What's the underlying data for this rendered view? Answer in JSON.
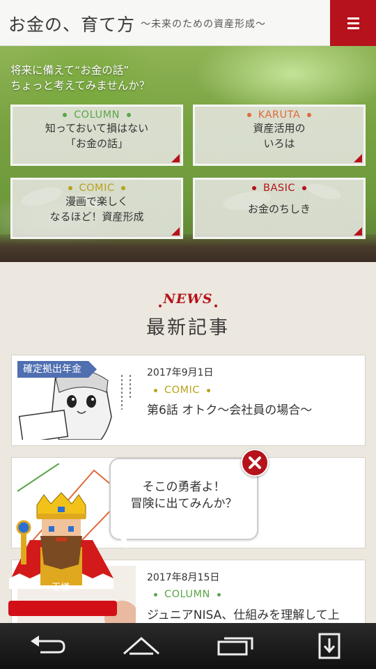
{
  "header": {
    "title": "お金の、育て方",
    "subtitle": "〜未来のための資産形成〜",
    "menu_icon": "hamburger-icon",
    "accent_color": "#b5121b"
  },
  "hero": {
    "line1": "将来に備えて“お金の話”",
    "line2": "ちょっと考えてみませんか？",
    "categories": [
      {
        "tag": "COLUMN",
        "color": "#5aa64a",
        "line1": "知っておいて損はない",
        "line2": "「お金の話」"
      },
      {
        "tag": "KARUTA",
        "color": "#e06a3b",
        "line1": "資産活用の",
        "line2": "いろは"
      },
      {
        "tag": "COMIC",
        "color": "#b8a21a",
        "line1": "漫画で楽しく",
        "line2": "なるほど！資産形成"
      },
      {
        "tag": "BASIC",
        "color": "#b5121b",
        "line1": "お金のちしき",
        "line2": ""
      }
    ]
  },
  "news": {
    "heading_en": "NEWS",
    "heading_ja": "最新記事",
    "articles": [
      {
        "badge": "確定拠出年金",
        "date": "2017年9月1日",
        "category": "COMIC",
        "category_color": "#b8a21a",
        "title": "第6話 オトク〜会社員の場合〜"
      },
      {
        "badge": "",
        "date": "",
        "category": "",
        "category_color": "",
        "title": ""
      },
      {
        "badge": "",
        "date": "2017年8月15日",
        "category": "COLUMN",
        "category_color": "#5aa64a",
        "title": "ジュニアNISA、仕組みを理解して上"
      }
    ]
  },
  "popup": {
    "line1": "そこの勇者よ！",
    "line2": "冒険に出てみんか？",
    "character_label": "王様",
    "close_icon": "close-icon"
  },
  "navbar": {
    "icons": [
      "back-icon",
      "home-icon",
      "recent-apps-icon",
      "download-icon"
    ]
  }
}
